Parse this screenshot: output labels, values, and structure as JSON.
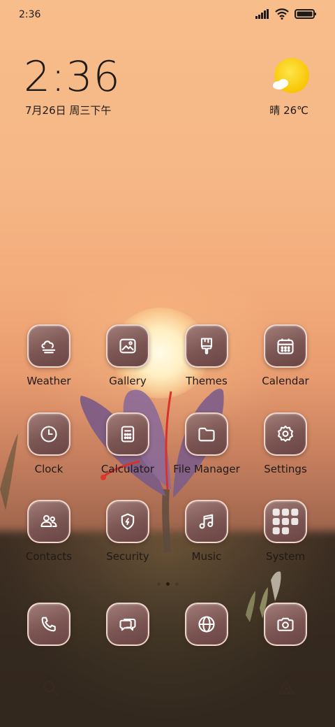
{
  "status_bar": {
    "time": "2:36"
  },
  "clock_widget": {
    "time": "2:36",
    "date": "7月26日 周三下午"
  },
  "weather_widget": {
    "text": "晴 26℃",
    "icon": "sunny-cloud-icon"
  },
  "apps": [
    {
      "label": "Weather",
      "icon": "weather-icon"
    },
    {
      "label": "Gallery",
      "icon": "gallery-icon"
    },
    {
      "label": "Themes",
      "icon": "themes-icon"
    },
    {
      "label": "Calendar",
      "icon": "calendar-icon"
    },
    {
      "label": "Clock",
      "icon": "clock-icon"
    },
    {
      "label": "Calculator",
      "icon": "calculator-icon"
    },
    {
      "label": "File Manager",
      "icon": "folder-icon"
    },
    {
      "label": "Settings",
      "icon": "gear-icon"
    },
    {
      "label": "Contacts",
      "icon": "contacts-icon"
    },
    {
      "label": "Security",
      "icon": "shield-icon"
    },
    {
      "label": "Music",
      "icon": "music-icon"
    },
    {
      "label": "System",
      "icon": "folder-grid-icon"
    }
  ],
  "dock": [
    {
      "icon": "phone-icon"
    },
    {
      "icon": "messages-icon"
    },
    {
      "icon": "browser-icon"
    },
    {
      "icon": "camera-icon"
    }
  ],
  "page_indicator": {
    "pages": 3,
    "active": 2
  },
  "bottom_bar": [
    {
      "icon": "search-icon"
    },
    {
      "icon": "assistant-icon"
    }
  ]
}
